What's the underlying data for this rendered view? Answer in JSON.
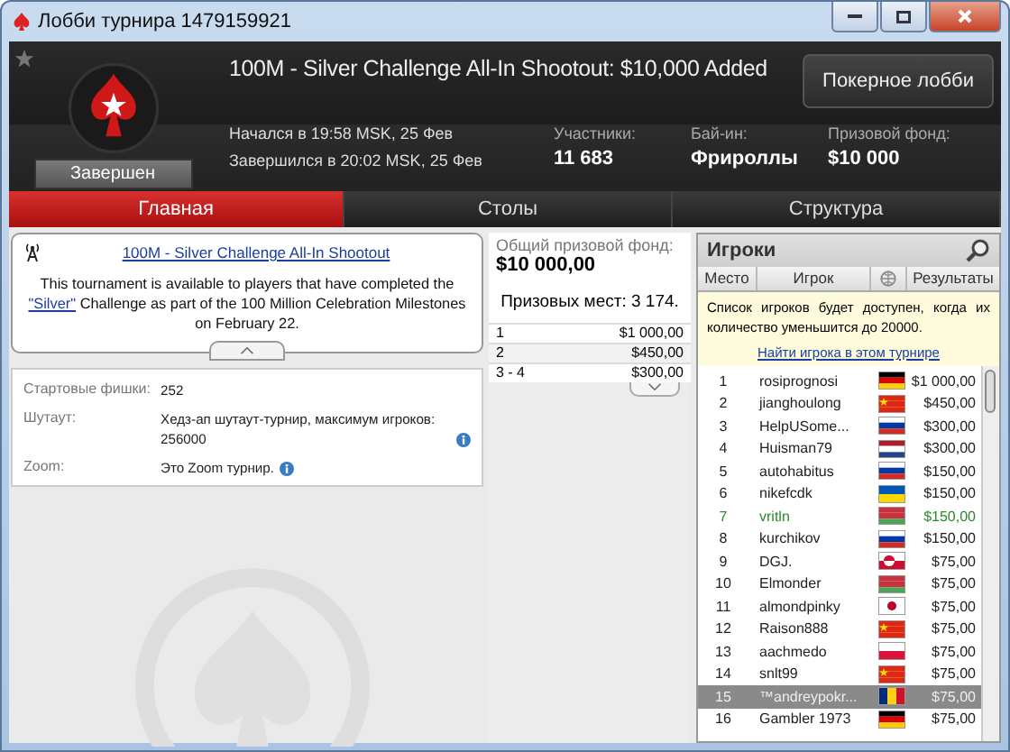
{
  "window": {
    "title": "Лобби турнира 1479159921"
  },
  "header": {
    "title": "100M - Silver Challenge All-In Shootout: $10,000 Added",
    "lobby_button": "Покерное лобби",
    "status": "Завершен",
    "started": "Начался в 19:58 MSK, 25 Фев",
    "finished": "Завершился в 20:02 MSK, 25 Фев",
    "stats": [
      {
        "label": "Участники:",
        "value": "11 683"
      },
      {
        "label": "Бай-ин:",
        "value": "Фрироллы"
      },
      {
        "label": "Призовой фонд:",
        "value": "$10 000"
      }
    ]
  },
  "tabs": [
    {
      "label": "Главная",
      "selected": true
    },
    {
      "label": "Столы",
      "selected": false
    },
    {
      "label": "Структура",
      "selected": false
    }
  ],
  "info": {
    "title_link": "100M - Silver Challenge All-In Shootout",
    "text_before": "This tournament is available to players that have completed the ",
    "link": "\"Silver\"",
    "text_after": " Challenge as part of the 100 Million Celebration Milestones on February 22.",
    "details": [
      {
        "label": "Стартовые фишки:",
        "value": "252"
      },
      {
        "label": "Шутаут:",
        "value": "Хедз-ап шутаут-турнир, максимум игроков: 256000",
        "info": true
      },
      {
        "label": "Zoom:",
        "value": "Это Zoom турнир.",
        "info": true
      }
    ]
  },
  "prizes": {
    "label": "Общий призовой фонд:",
    "total": "$10 000,00",
    "places": "Призовых мест: 3 174.",
    "rows": [
      {
        "place": "1",
        "amount": "$1 000,00"
      },
      {
        "place": "2",
        "amount": "$450,00"
      },
      {
        "place": "3 - 4",
        "amount": "$300,00"
      }
    ]
  },
  "players": {
    "title": "Игроки",
    "columns": [
      "Место",
      "Игрок",
      "Результаты"
    ],
    "notice": "Список игроков будет доступен, когда их количество уменьшится до 20000.",
    "find_link": "Найти игрока в этом турнире",
    "rows": [
      {
        "place": "1",
        "name": "rosiprognosi",
        "kind": "germany",
        "result": "$1 000,00",
        "selected": false,
        "highlighted": false
      },
      {
        "place": "2",
        "name": "jianghoulong",
        "kind": "china",
        "result": "$450,00",
        "selected": false,
        "highlighted": false
      },
      {
        "place": "3",
        "name": "HelpUSome...",
        "kind": "russia",
        "result": "$300,00",
        "selected": false,
        "highlighted": false
      },
      {
        "place": "4",
        "name": "Huisman79",
        "kind": "netherlands",
        "result": "$300,00",
        "selected": false,
        "highlighted": false
      },
      {
        "place": "5",
        "name": "autohabitus",
        "kind": "russia",
        "result": "$150,00",
        "selected": false,
        "highlighted": false
      },
      {
        "place": "6",
        "name": "nikefcdk",
        "kind": "ukraine",
        "result": "$150,00",
        "selected": false,
        "highlighted": false
      },
      {
        "place": "7",
        "name": "vritln",
        "kind": "belarus",
        "result": "$150,00",
        "selected": false,
        "highlighted": true
      },
      {
        "place": "8",
        "name": "kurchikov",
        "kind": "russia",
        "result": "$150,00",
        "selected": false,
        "highlighted": false
      },
      {
        "place": "9",
        "name": "DGJ.",
        "kind": "greenland",
        "result": "$75,00",
        "selected": false,
        "highlighted": false
      },
      {
        "place": "10",
        "name": "Elmonder",
        "kind": "belarus",
        "result": "$75,00",
        "selected": false,
        "highlighted": false
      },
      {
        "place": "11",
        "name": "almondpinky",
        "kind": "japan",
        "result": "$75,00",
        "selected": false,
        "highlighted": false
      },
      {
        "place": "12",
        "name": "Raison888",
        "kind": "china",
        "result": "$75,00",
        "selected": false,
        "highlighted": false
      },
      {
        "place": "13",
        "name": "aachmedo",
        "kind": "poland",
        "result": "$75,00",
        "selected": false,
        "highlighted": false
      },
      {
        "place": "14",
        "name": "snlt99",
        "kind": "china",
        "result": "$75,00",
        "selected": false,
        "highlighted": false
      },
      {
        "place": "15",
        "name": "™andreypokr...",
        "kind": "romania",
        "result": "$75,00",
        "selected": true,
        "highlighted": false
      },
      {
        "place": "16",
        "name": "Gambler 1973",
        "kind": "germany",
        "result": "$75,00",
        "selected": false,
        "highlighted": false
      }
    ]
  }
}
